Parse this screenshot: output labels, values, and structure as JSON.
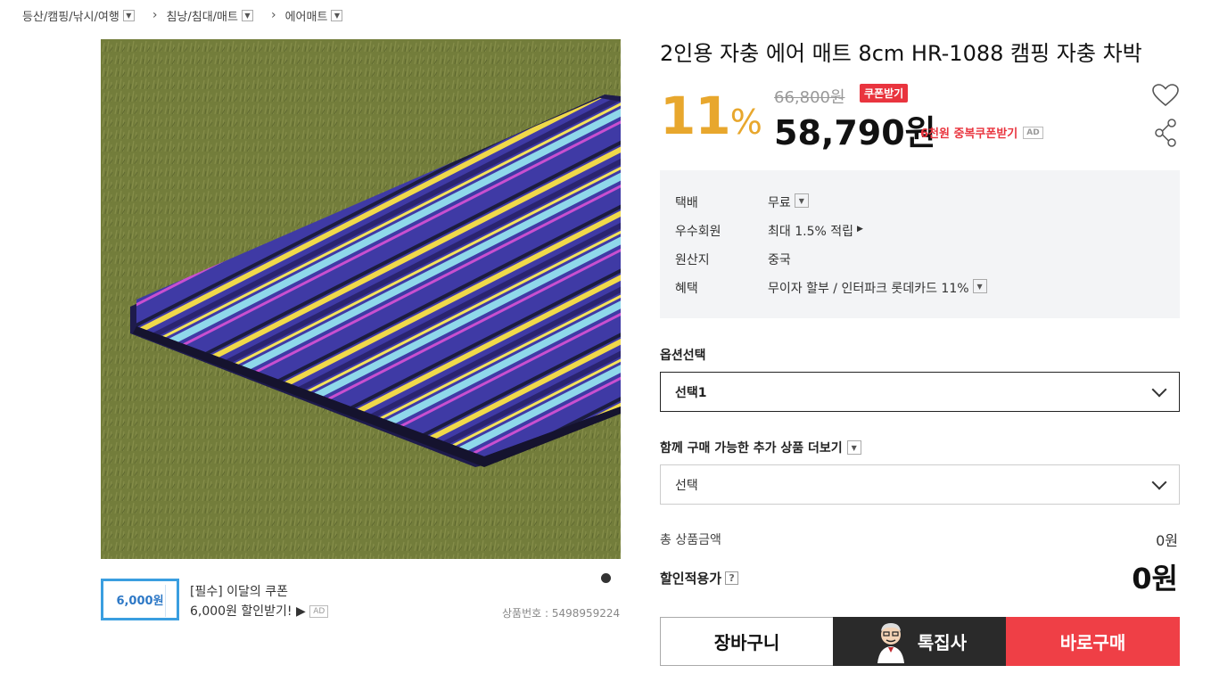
{
  "breadcrumb": [
    {
      "label": "등산/캠핑/낚시/여행"
    },
    {
      "label": "침낭/침대/매트"
    },
    {
      "label": "에어매트"
    }
  ],
  "product": {
    "title": "2인용 자충 에어 매트 8cm HR-1088 캠핑 자충 차박",
    "discount_number": "11",
    "discount_symbol": "%",
    "original_price": "66,800원",
    "coupon_tag": "쿠폰받기",
    "price": "58,790원",
    "dup_coupon": "6천원 중복쿠폰받기",
    "ad_label": "AD",
    "product_no": "상품번호 : 5498959224"
  },
  "coupon_banner": {
    "amount": "6,000원",
    "line1": "[필수] 이달의 쿠폰",
    "line2": "6,000원  할인받기! ▶",
    "ad_label": "AD"
  },
  "info": [
    {
      "key": "택배",
      "value": "무료"
    },
    {
      "key": "우수회원",
      "value": "최대 1.5% 적립"
    },
    {
      "key": "원산지",
      "value": "중국"
    },
    {
      "key": "혜택",
      "value": "무이자 할부 / 인터파크 롯데카드 11%"
    }
  ],
  "options": {
    "label": "옵션선택",
    "selected": "선택1",
    "extra_label": "함께 구매 가능한 추가 상품 더보기",
    "extra_selected": "선택"
  },
  "totals": {
    "total_label": "총 상품금액",
    "total_value": "0원",
    "discount_label": "할인적용가",
    "discount_help": "?",
    "discount_value": "0원"
  },
  "buttons": {
    "cart": "장바구니",
    "special": "톡집사",
    "buy": "바로구매"
  },
  "colors": {
    "discount": "#e8a72d",
    "accent_red": "#ef3f46",
    "coupon_blue": "#3a9ee0"
  }
}
